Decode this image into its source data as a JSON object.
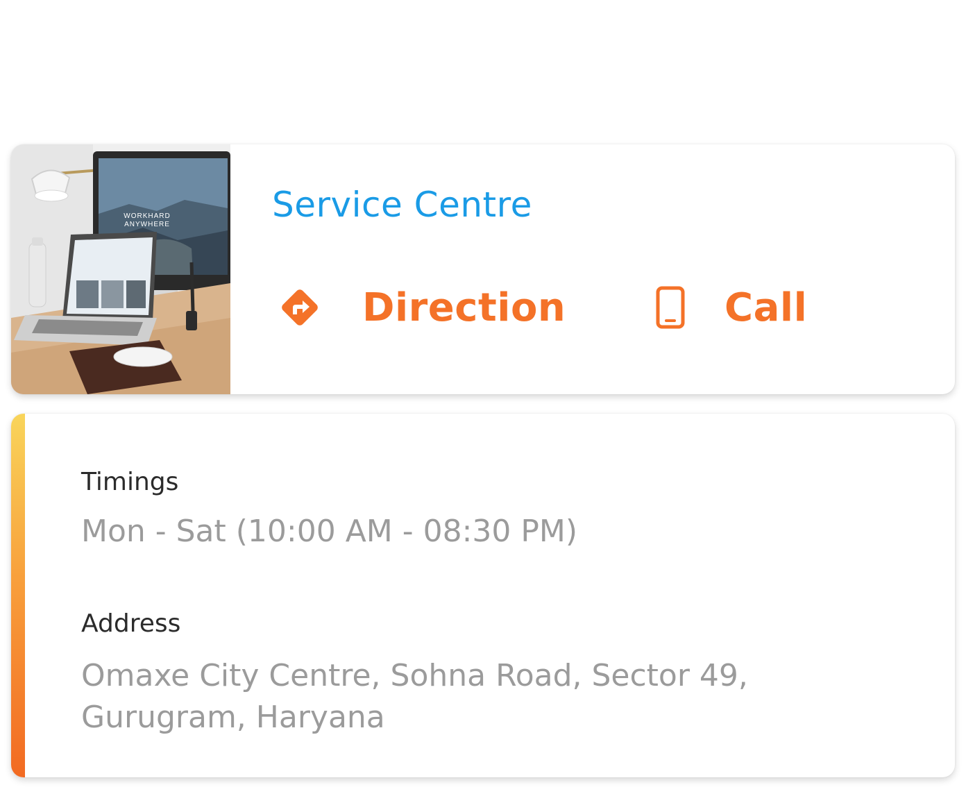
{
  "card": {
    "title": "Service Centre",
    "image_alt": "desk with monitor and laptop",
    "monitor_text_line1": "WORKHARD",
    "monitor_text_line2": "ANYWHERE"
  },
  "actions": {
    "direction": {
      "label": "Direction",
      "icon": "directions-icon"
    },
    "call": {
      "label": "Call",
      "icon": "phone-icon"
    }
  },
  "info": {
    "timings_heading": "Timings",
    "timings_value": "Mon - Sat (10:00 AM - 08:30 PM)",
    "address_heading": "Address",
    "address_value": "Omaxe City Centre, Sohna Road, Sector 49,\nGurugram, Haryana"
  },
  "colors": {
    "title": "#1a9be6",
    "accent": "#f47228",
    "accent_gradient_top": "#f9d55b",
    "accent_gradient_bottom": "#f26a22",
    "heading": "#2b2b2b",
    "muted": "#9b9b9b"
  }
}
